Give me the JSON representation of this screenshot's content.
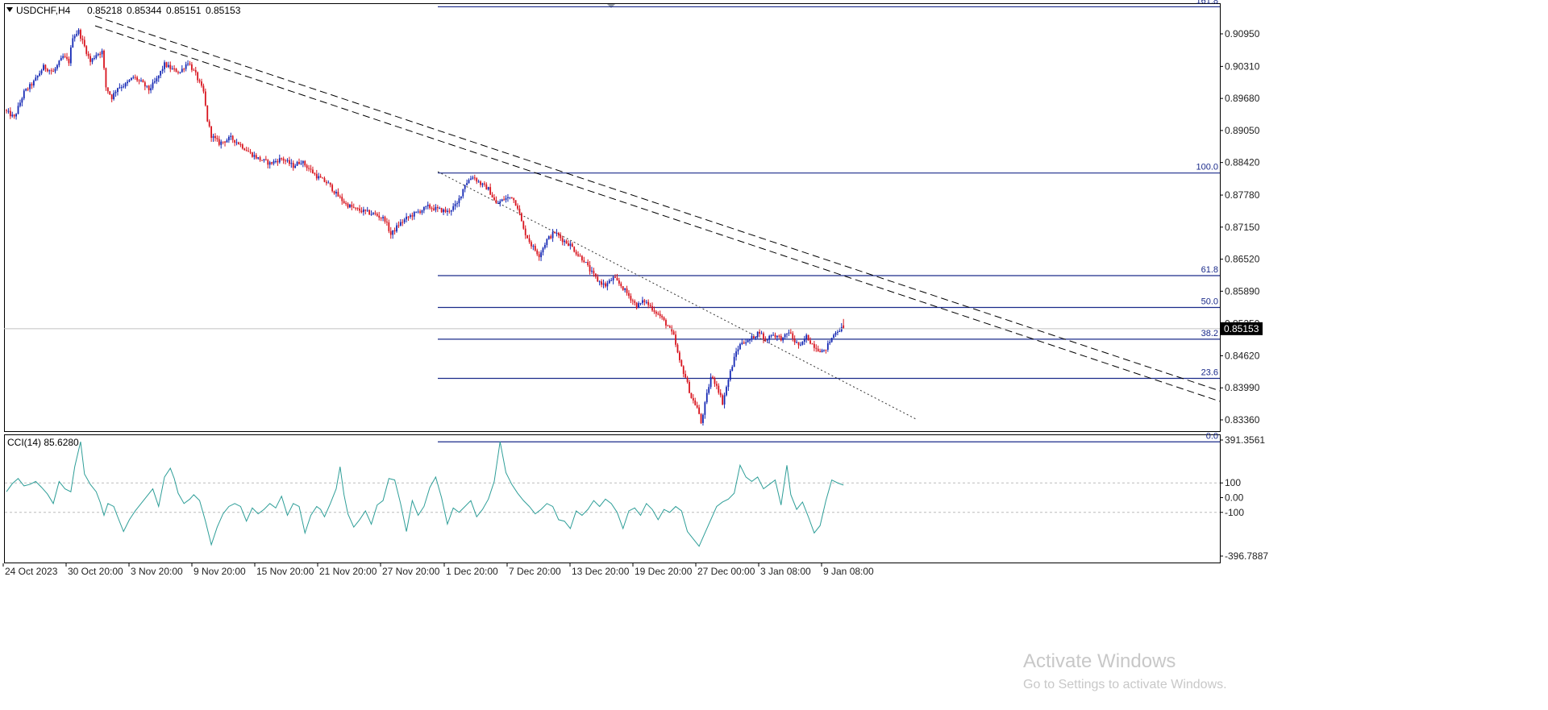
{
  "header": {
    "symbol_label": "USDCHF,H4",
    "ohlc": [
      "0.85218",
      "0.85344",
      "0.85151",
      "0.85153"
    ]
  },
  "indicator": {
    "label": "CCI(14) 85.6280",
    "scale_labels": [
      "391.3561",
      "100",
      "0.00",
      "-100",
      "-396.7887"
    ],
    "max": 391.3561,
    "min": -396.7887,
    "levels": [
      100,
      -100
    ],
    "line_color": "#2e9e98",
    "points": [
      [
        0,
        40
      ],
      [
        3,
        95
      ],
      [
        6,
        130
      ],
      [
        9,
        80
      ],
      [
        12,
        90
      ],
      [
        15,
        110
      ],
      [
        18,
        70
      ],
      [
        21,
        25
      ],
      [
        24,
        -40
      ],
      [
        27,
        110
      ],
      [
        30,
        60
      ],
      [
        33,
        40
      ],
      [
        35,
        210
      ],
      [
        38,
        380
      ],
      [
        40,
        160
      ],
      [
        43,
        90
      ],
      [
        46,
        40
      ],
      [
        48,
        -30
      ],
      [
        50,
        -120
      ],
      [
        52,
        -40
      ],
      [
        55,
        -60
      ],
      [
        57,
        -130
      ],
      [
        60,
        -230
      ],
      [
        63,
        -150
      ],
      [
        66,
        -90
      ],
      [
        69,
        -40
      ],
      [
        72,
        10
      ],
      [
        75,
        60
      ],
      [
        78,
        -60
      ],
      [
        81,
        140
      ],
      [
        84,
        200
      ],
      [
        86,
        130
      ],
      [
        88,
        30
      ],
      [
        91,
        -40
      ],
      [
        94,
        -10
      ],
      [
        96,
        20
      ],
      [
        99,
        -20
      ],
      [
        102,
        -160
      ],
      [
        105,
        -320
      ],
      [
        108,
        -200
      ],
      [
        111,
        -110
      ],
      [
        114,
        -60
      ],
      [
        117,
        -40
      ],
      [
        120,
        -60
      ],
      [
        123,
        -160
      ],
      [
        126,
        -70
      ],
      [
        129,
        -110
      ],
      [
        132,
        -80
      ],
      [
        135,
        -40
      ],
      [
        138,
        -70
      ],
      [
        141,
        10
      ],
      [
        144,
        -120
      ],
      [
        147,
        -40
      ],
      [
        150,
        -60
      ],
      [
        153,
        -240
      ],
      [
        156,
        -120
      ],
      [
        159,
        -60
      ],
      [
        161,
        -80
      ],
      [
        163,
        -130
      ],
      [
        166,
        -40
      ],
      [
        169,
        60
      ],
      [
        171,
        210
      ],
      [
        173,
        20
      ],
      [
        175,
        -110
      ],
      [
        178,
        -200
      ],
      [
        181,
        -150
      ],
      [
        184,
        -90
      ],
      [
        187,
        -180
      ],
      [
        190,
        -50
      ],
      [
        193,
        -20
      ],
      [
        196,
        130
      ],
      [
        199,
        120
      ],
      [
        202,
        -40
      ],
      [
        205,
        -230
      ],
      [
        208,
        -20
      ],
      [
        211,
        -120
      ],
      [
        214,
        -60
      ],
      [
        217,
        70
      ],
      [
        220,
        140
      ],
      [
        223,
        0
      ],
      [
        226,
        -180
      ],
      [
        229,
        -70
      ],
      [
        232,
        -100
      ],
      [
        235,
        -60
      ],
      [
        238,
        -20
      ],
      [
        241,
        -130
      ],
      [
        244,
        -80
      ],
      [
        247,
        -10
      ],
      [
        250,
        110
      ],
      [
        253,
        380
      ],
      [
        256,
        170
      ],
      [
        259,
        90
      ],
      [
        262,
        30
      ],
      [
        265,
        -20
      ],
      [
        268,
        -60
      ],
      [
        271,
        -110
      ],
      [
        274,
        -80
      ],
      [
        277,
        -40
      ],
      [
        280,
        -60
      ],
      [
        283,
        -150
      ],
      [
        286,
        -160
      ],
      [
        289,
        -210
      ],
      [
        292,
        -90
      ],
      [
        295,
        -120
      ],
      [
        298,
        -80
      ],
      [
        301,
        -20
      ],
      [
        304,
        -60
      ],
      [
        307,
        -10
      ],
      [
        310,
        -40
      ],
      [
        313,
        -100
      ],
      [
        316,
        -210
      ],
      [
        319,
        -90
      ],
      [
        322,
        -70
      ],
      [
        325,
        -120
      ],
      [
        328,
        -40
      ],
      [
        331,
        -80
      ],
      [
        334,
        -150
      ],
      [
        337,
        -80
      ],
      [
        340,
        -100
      ],
      [
        343,
        -60
      ],
      [
        346,
        -90
      ],
      [
        349,
        -230
      ],
      [
        352,
        -280
      ],
      [
        355,
        -330
      ],
      [
        358,
        -240
      ],
      [
        361,
        -150
      ],
      [
        364,
        -60
      ],
      [
        367,
        -30
      ],
      [
        370,
        -10
      ],
      [
        373,
        30
      ],
      [
        376,
        220
      ],
      [
        379,
        140
      ],
      [
        382,
        110
      ],
      [
        385,
        140
      ],
      [
        388,
        60
      ],
      [
        391,
        90
      ],
      [
        394,
        120
      ],
      [
        397,
        -50
      ],
      [
        400,
        220
      ],
      [
        402,
        20
      ],
      [
        405,
        -80
      ],
      [
        408,
        -30
      ],
      [
        411,
        -130
      ],
      [
        414,
        -240
      ],
      [
        417,
        -190
      ],
      [
        420,
        -20
      ],
      [
        423,
        120
      ],
      [
        426,
        100
      ],
      [
        429,
        85.628
      ]
    ]
  },
  "price_axis": {
    "labels": [
      "0.90950",
      "0.90310",
      "0.89680",
      "0.89050",
      "0.88420",
      "0.87780",
      "0.87150",
      "0.86520",
      "0.85890",
      "0.85250",
      "0.84620",
      "0.83990",
      "0.83360"
    ],
    "current_price": "0.85153",
    "current_price_value": 0.85153
  },
  "time_axis": {
    "labels": [
      "24 Oct 2023",
      "30 Oct 20:00",
      "3 Nov 20:00",
      "9 Nov 20:00",
      "15 Nov 20:00",
      "21 Nov 20:00",
      "27 Nov 20:00",
      "1 Dec 20:00",
      "7 Dec 20:00",
      "13 Dec 20:00",
      "19 Dec 20:00",
      "27 Dec 00:00",
      "3 Jan 08:00",
      "9 Jan 08:00"
    ]
  },
  "fibonacci": {
    "level_labels": [
      "161.8",
      "100.0",
      "61.8",
      "50.0",
      "38.2",
      "23.6",
      "0.0"
    ],
    "level_prices": [
      0.91482,
      0.88214,
      0.86196,
      0.85571,
      0.84947,
      0.84176,
      0.82928
    ],
    "line_color": "#1a2a8a"
  },
  "trendlines": {
    "color": "#000000",
    "style": [
      "dashed",
      "dashed",
      "dotted"
    ]
  },
  "colors": {
    "bull": "#1428b4",
    "bear": "#d8141e",
    "background": "#ffffff",
    "grid_frame": "#000000"
  },
  "watermark": {
    "line1": "Activate Windows",
    "line2": "Go to Settings to activate Windows."
  },
  "chart_data": {
    "type": "candlestick",
    "title": "USDCHF,H4",
    "xlabel": "",
    "ylabel": "",
    "ylim": [
      0.828,
      0.915
    ],
    "grid": false,
    "anchors": [
      [
        0,
        0.8945
      ],
      [
        5,
        0.893
      ],
      [
        10,
        0.898
      ],
      [
        15,
        0.9
      ],
      [
        20,
        0.903
      ],
      [
        25,
        0.902
      ],
      [
        30,
        0.905
      ],
      [
        33,
        0.904
      ],
      [
        35,
        0.909
      ],
      [
        38,
        0.91
      ],
      [
        41,
        0.907
      ],
      [
        44,
        0.904
      ],
      [
        47,
        0.9055
      ],
      [
        50,
        0.906
      ],
      [
        52,
        0.899
      ],
      [
        55,
        0.897
      ],
      [
        58,
        0.899
      ],
      [
        62,
        0.8995
      ],
      [
        66,
        0.901
      ],
      [
        70,
        0.9
      ],
      [
        74,
        0.8985
      ],
      [
        78,
        0.9005
      ],
      [
        82,
        0.9035
      ],
      [
        86,
        0.9025
      ],
      [
        90,
        0.902
      ],
      [
        94,
        0.904
      ],
      [
        98,
        0.9015
      ],
      [
        102,
        0.898
      ],
      [
        104,
        0.8925
      ],
      [
        106,
        0.8895
      ],
      [
        110,
        0.888
      ],
      [
        116,
        0.889
      ],
      [
        120,
        0.888
      ],
      [
        126,
        0.886
      ],
      [
        130,
        0.885
      ],
      [
        136,
        0.884
      ],
      [
        142,
        0.885
      ],
      [
        148,
        0.8835
      ],
      [
        152,
        0.8845
      ],
      [
        156,
        0.883
      ],
      [
        160,
        0.8815
      ],
      [
        166,
        0.88
      ],
      [
        170,
        0.878
      ],
      [
        175,
        0.876
      ],
      [
        180,
        0.875
      ],
      [
        185,
        0.8745
      ],
      [
        190,
        0.874
      ],
      [
        195,
        0.873
      ],
      [
        198,
        0.87
      ],
      [
        202,
        0.872
      ],
      [
        207,
        0.8735
      ],
      [
        212,
        0.8745
      ],
      [
        217,
        0.8755
      ],
      [
        222,
        0.875
      ],
      [
        227,
        0.8745
      ],
      [
        232,
        0.876
      ],
      [
        236,
        0.88
      ],
      [
        240,
        0.8815
      ],
      [
        244,
        0.88
      ],
      [
        248,
        0.879
      ],
      [
        252,
        0.876
      ],
      [
        256,
        0.877
      ],
      [
        260,
        0.8775
      ],
      [
        263,
        0.8755
      ],
      [
        266,
        0.871
      ],
      [
        270,
        0.868
      ],
      [
        274,
        0.866
      ],
      [
        278,
        0.869
      ],
      [
        282,
        0.8705
      ],
      [
        286,
        0.869
      ],
      [
        290,
        0.868
      ],
      [
        294,
        0.866
      ],
      [
        297,
        0.865
      ],
      [
        300,
        0.863
      ],
      [
        304,
        0.861
      ],
      [
        308,
        0.86
      ],
      [
        312,
        0.8615
      ],
      [
        316,
        0.86
      ],
      [
        320,
        0.858
      ],
      [
        324,
        0.856
      ],
      [
        328,
        0.857
      ],
      [
        332,
        0.8555
      ],
      [
        336,
        0.854
      ],
      [
        340,
        0.852
      ],
      [
        343,
        0.85
      ],
      [
        346,
        0.845
      ],
      [
        349,
        0.842
      ],
      [
        352,
        0.838
      ],
      [
        355,
        0.836
      ],
      [
        357,
        0.833
      ],
      [
        360,
        0.8385
      ],
      [
        362,
        0.842
      ],
      [
        365,
        0.8405
      ],
      [
        368,
        0.837
      ],
      [
        370,
        0.84
      ],
      [
        372,
        0.843
      ],
      [
        375,
        0.847
      ],
      [
        378,
        0.849
      ],
      [
        381,
        0.849
      ],
      [
        384,
        0.85
      ],
      [
        387,
        0.851
      ],
      [
        390,
        0.849
      ],
      [
        393,
        0.8505
      ],
      [
        396,
        0.85
      ],
      [
        399,
        0.8495
      ],
      [
        402,
        0.851
      ],
      [
        405,
        0.849
      ],
      [
        408,
        0.848
      ],
      [
        411,
        0.85
      ],
      [
        414,
        0.8485
      ],
      [
        417,
        0.8475
      ],
      [
        420,
        0.847
      ],
      [
        423,
        0.849
      ],
      [
        426,
        0.851
      ],
      [
        429,
        0.85153
      ]
    ],
    "bar_count": 430,
    "last_bar": {
      "open": 0.85218,
      "high": 0.85344,
      "low": 0.85151,
      "close": 0.85153
    }
  }
}
